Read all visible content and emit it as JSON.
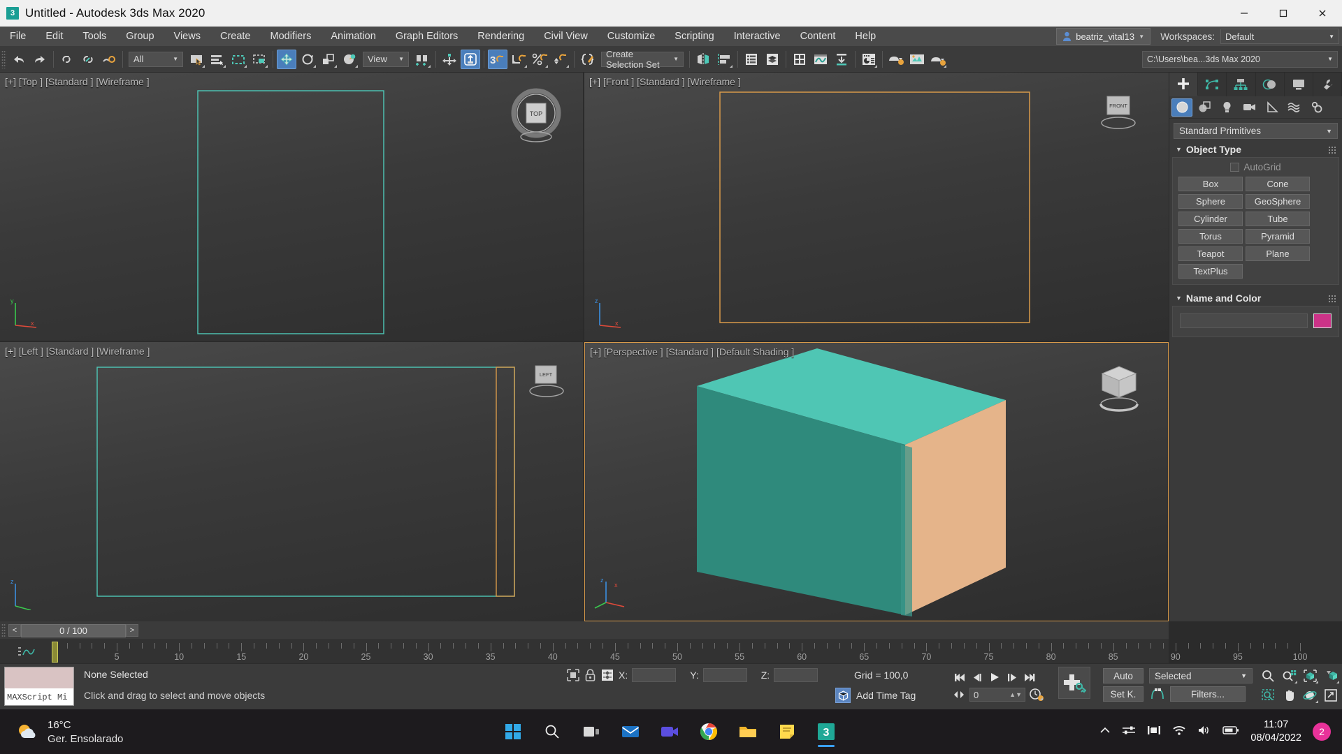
{
  "window": {
    "title": "Untitled - Autodesk 3ds Max 2020",
    "app_icon": "3ds-max-icon",
    "minimize": "–",
    "maximize": "❐",
    "close": "✕"
  },
  "menubar": {
    "items": [
      {
        "label": "File"
      },
      {
        "label": "Edit"
      },
      {
        "label": "Tools"
      },
      {
        "label": "Group"
      },
      {
        "label": "Views"
      },
      {
        "label": "Create"
      },
      {
        "label": "Modifiers"
      },
      {
        "label": "Animation"
      },
      {
        "label": "Graph Editors"
      },
      {
        "label": "Rendering"
      },
      {
        "label": "Civil View"
      },
      {
        "label": "Customize"
      },
      {
        "label": "Scripting"
      },
      {
        "label": "Interactive"
      },
      {
        "label": "Content"
      },
      {
        "label": "Help"
      }
    ],
    "user": "beatriz_vital13",
    "workspaces_label": "Workspaces:",
    "workspace_value": "Default",
    "caret": "▼"
  },
  "toolbar": {
    "undo": "undo-icon",
    "redo": "redo-icon",
    "select_filter_value": "All",
    "reference_coord_value": "View",
    "selection_set_value": "Create Selection Set",
    "file_path": "C:\\Users\\bea...3ds Max 2020",
    "caret": "▼"
  },
  "viewports": [
    {
      "id": "top",
      "label_prefix": "[+]",
      "view": "[Top ]",
      "shading": "[Standard ]",
      "display": "[Wireframe ]",
      "active": false
    },
    {
      "id": "front",
      "label_prefix": "[+]",
      "view": "[Front ]",
      "shading": "[Standard ]",
      "display": "[Wireframe ]",
      "active": false
    },
    {
      "id": "left",
      "label_prefix": "[+]",
      "view": "[Left ]",
      "shading": "[Standard ]",
      "display": "[Wireframe ]",
      "active": false
    },
    {
      "id": "perspective",
      "label_prefix": "[+]",
      "view": "[Perspective ]",
      "shading": "[Standard ]",
      "display": "[Default Shading ]",
      "active": true
    }
  ],
  "viewcube": {
    "top_face": "TOP",
    "front_face": "FRONT",
    "left_face": "LEFT"
  },
  "command_panel": {
    "tabs": [
      {
        "name": "create",
        "icon": "plus-icon",
        "selected": true
      },
      {
        "name": "modify",
        "icon": "modify-icon",
        "selected": false
      },
      {
        "name": "hierarchy",
        "icon": "hierarchy-icon",
        "selected": false
      },
      {
        "name": "motion",
        "icon": "motion-icon",
        "selected": false
      },
      {
        "name": "display",
        "icon": "display-icon",
        "selected": false
      },
      {
        "name": "utilities",
        "icon": "wrench-icon",
        "selected": false
      }
    ],
    "category_buttons": [
      {
        "name": "geometry",
        "icon": "sphere-icon",
        "selected": true
      },
      {
        "name": "shapes",
        "icon": "shapes-icon",
        "selected": false
      },
      {
        "name": "lights",
        "icon": "light-bulb-icon",
        "selected": false
      },
      {
        "name": "cameras",
        "icon": "camera-icon",
        "selected": false
      },
      {
        "name": "helpers",
        "icon": "tape-measure-icon",
        "selected": false
      },
      {
        "name": "space-warps",
        "icon": "waves-icon",
        "selected": false
      },
      {
        "name": "systems",
        "icon": "gears-icon",
        "selected": false
      }
    ],
    "subcategory": "Standard Primitives",
    "object_type": {
      "title": "Object Type",
      "autogrid_label": "AutoGrid",
      "autogrid_checked": false,
      "buttons": [
        "Box",
        "Cone",
        "Sphere",
        "GeoSphere",
        "Cylinder",
        "Tube",
        "Torus",
        "Pyramid",
        "Teapot",
        "Plane",
        "TextPlus"
      ]
    },
    "name_and_color": {
      "title": "Name and Color",
      "name_value": "",
      "color": "#cc3388"
    }
  },
  "time_slider": {
    "prev": "<",
    "next": ">",
    "value": "0 / 100"
  },
  "trackbar": {
    "ticks": [
      0,
      5,
      10,
      15,
      20,
      25,
      30,
      35,
      40,
      45,
      50,
      55,
      60,
      65,
      70,
      75,
      80,
      85,
      90,
      95,
      100
    ],
    "current_frame": 0
  },
  "status_bar": {
    "maxscript_label": "MAXScript Mi",
    "selection_status": "None Selected",
    "prompt": "Click and drag to select and move objects",
    "x_label": "X:",
    "y_label": "Y:",
    "z_label": "Z:",
    "x_value": "",
    "y_value": "",
    "z_value": "",
    "grid_text": "Grid = 100,0",
    "add_time_tag": "Add Time Tag"
  },
  "animation": {
    "auto_key": "Auto",
    "set_key": "Set K.",
    "key_filters": "Filters...",
    "selection_level": "Selected",
    "current_frame": "0",
    "caret": "▼",
    "playback_buttons": [
      "go-to-start-icon",
      "previous-frame-icon",
      "play-icon",
      "next-frame-icon",
      "go-to-end-icon"
    ],
    "nav_icons": [
      "zoom-icon",
      "zoom-all-icon",
      "zoom-extents-icon",
      "zoom-extents-selected-icon",
      "zoom-region-icon",
      "pan-icon",
      "orbit-icon",
      "maximize-viewport-icon"
    ]
  },
  "taskbar": {
    "weather_temp": "16°C",
    "weather_desc": "Ger. Ensolarado",
    "apps": [
      {
        "name": "start-button",
        "icon": "windows-logo"
      },
      {
        "name": "search",
        "icon": "search-icon"
      },
      {
        "name": "task-view",
        "icon": "task-view-icon"
      },
      {
        "name": "mail",
        "icon": "mail-icon"
      },
      {
        "name": "video",
        "icon": "video-icon"
      },
      {
        "name": "chrome",
        "icon": "chrome-icon"
      },
      {
        "name": "file-explorer",
        "icon": "folder-icon"
      },
      {
        "name": "sticky-notes",
        "icon": "notes-icon"
      },
      {
        "name": "3ds-max",
        "icon": "3ds-max-icon"
      }
    ],
    "tray": [
      "chevron-up-icon",
      "settings-icon",
      "intel-icon",
      "wifi-icon",
      "volume-icon",
      "battery-icon"
    ],
    "time": "11:07",
    "date": "08/04/2022",
    "notification_count": "2"
  },
  "colors": {
    "accent_teal": "#4ec9b8",
    "accent_orange": "#d89a4a",
    "box_top": "#4fc6b4",
    "box_left": "#2f8a7c",
    "box_right": "#e5b48a",
    "highlight_blue": "#4a7ebb",
    "name_color_swatch": "#cc3388"
  }
}
